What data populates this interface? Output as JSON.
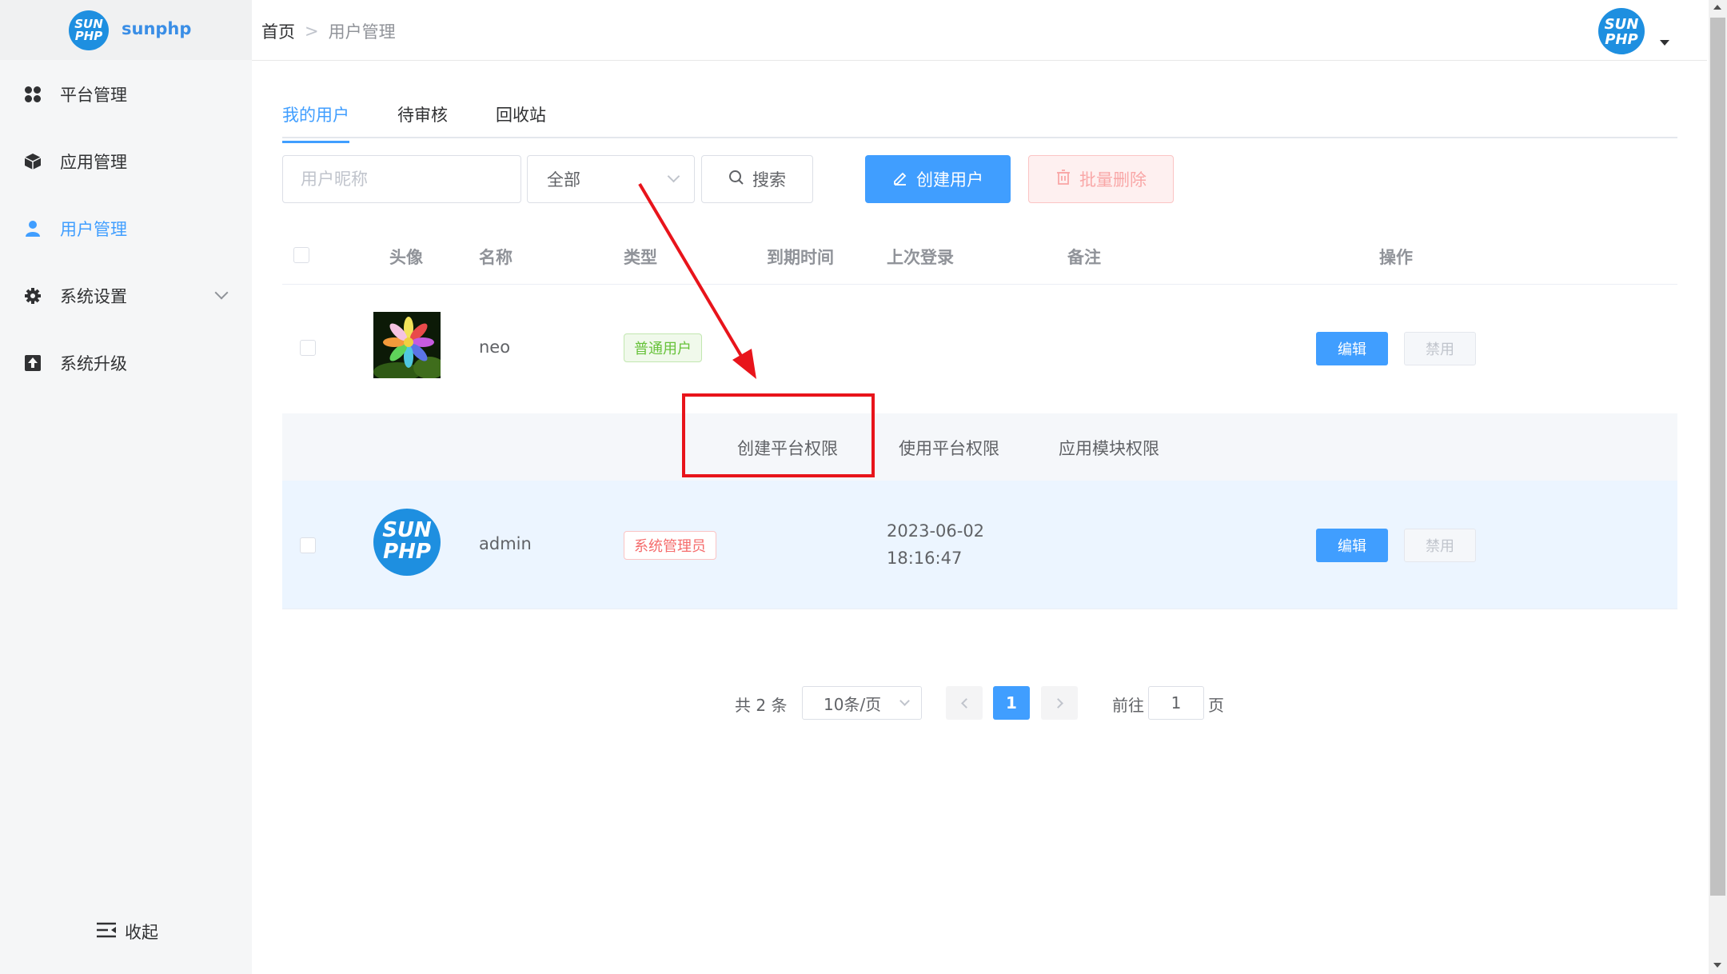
{
  "app": {
    "name": "sunphp",
    "logo_line1": "SUN",
    "logo_line2": "PHP"
  },
  "sidebar": {
    "items": [
      {
        "label": "平台管理",
        "icon": "grid-icon"
      },
      {
        "label": "应用管理",
        "icon": "cube-icon"
      },
      {
        "label": "用户管理",
        "icon": "user-icon",
        "active": true
      },
      {
        "label": "系统设置",
        "icon": "gear-icon",
        "has_submenu": true
      },
      {
        "label": "系统升级",
        "icon": "upload-icon"
      }
    ],
    "collapse_label": "收起"
  },
  "breadcrumb": {
    "home": "首页",
    "separator": ">",
    "current": "用户管理"
  },
  "header": {
    "avatar_line1": "SUN",
    "avatar_line2": "PHP"
  },
  "tabs": [
    {
      "label": "我的用户",
      "active": true
    },
    {
      "label": "待审核"
    },
    {
      "label": "回收站"
    }
  ],
  "toolbar": {
    "search_placeholder": "用户昵称",
    "search_value": "",
    "type_select_value": "全部",
    "search_label": "搜索",
    "create_label": "创建用户",
    "delete_label": "批量删除"
  },
  "table": {
    "headers": {
      "avatar": "头像",
      "name": "名称",
      "type": "类型",
      "expire": "到期时间",
      "last_login": "上次登录",
      "remark": "备注",
      "actions": "操作"
    },
    "rows": [
      {
        "name": "neo",
        "type": "普通用户",
        "expire": "",
        "last_login_date": "",
        "last_login_time": "",
        "remark": "",
        "edit": "编辑",
        "disable": "禁用"
      },
      {
        "name": "admin",
        "type": "系统管理员",
        "expire": "",
        "last_login_date": "2023-06-02",
        "last_login_time": "18:16:47",
        "remark": "",
        "edit": "编辑",
        "disable": "禁用",
        "avatar_line1": "SUN",
        "avatar_line2": "PHP"
      }
    ],
    "expanded_permissions": [
      "创建平台权限",
      "使用平台权限",
      "应用模块权限"
    ]
  },
  "pagination": {
    "total_label": "共 2 条",
    "page_size": "10条/页",
    "current_page": "1",
    "goto_label": "前往",
    "goto_value": "1",
    "page_suffix": "页"
  },
  "colors": {
    "primary": "#409eff",
    "danger": "#f56c6c",
    "success": "#67c23a",
    "annotation": "#e8141b"
  }
}
